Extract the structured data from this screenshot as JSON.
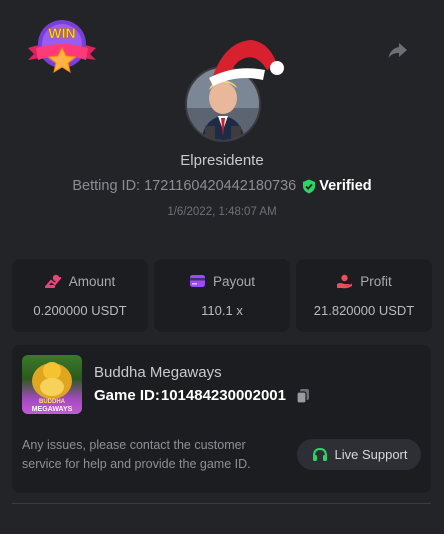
{
  "header": {
    "badge_text": "WIN",
    "share_icon": "share-icon"
  },
  "user": {
    "name": "Elpresidente",
    "betting_id_label": "Betting ID:",
    "betting_id": "1721160420442180736",
    "verified_label": "Verified",
    "date": "1/6/2022, 1:48:07 AM"
  },
  "stats": {
    "amount_label": "Amount",
    "amount_value": "0.200000 USDT",
    "payout_label": "Payout",
    "payout_value": "110.1 x",
    "profit_label": "Profit",
    "profit_value": "21.820000 USDT"
  },
  "game": {
    "name": "Buddha Megaways",
    "id_label": "Game ID:",
    "id_value": "101484230002001",
    "thumb_line1": "BUDDHA",
    "thumb_line2": "MEGAWAYS",
    "help_text": "Any issues, please contact the customer service for help and provide the game ID.",
    "support_label": "Live Support"
  },
  "colors": {
    "background": "#232428",
    "card": "#1c1d20",
    "verified_green": "#2bd566",
    "amount_icon": "#e6457a",
    "payout_icon": "#9b4df0",
    "profit_icon": "#e8505b",
    "support_icon": "#2bd566"
  }
}
